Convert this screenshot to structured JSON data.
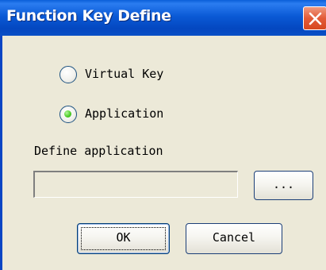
{
  "window": {
    "title": "Function Key Define"
  },
  "options": {
    "selected": "application",
    "items": [
      {
        "id": "virtual_key",
        "label": "Virtual Key",
        "checked": false
      },
      {
        "id": "application",
        "label": "Application",
        "checked": true
      }
    ]
  },
  "define": {
    "label": "Define application",
    "value": "",
    "browse_label": "..."
  },
  "footer": {
    "ok_label": "OK",
    "cancel_label": "Cancel"
  },
  "icons": {
    "close": "close-icon",
    "radio": "radio-button-icon"
  },
  "colors": {
    "titlebar": "#0a5ad6",
    "dialog_bg": "#ece9d8",
    "close_button": "#e35b38",
    "radio_selected": "#4fcf2a"
  }
}
